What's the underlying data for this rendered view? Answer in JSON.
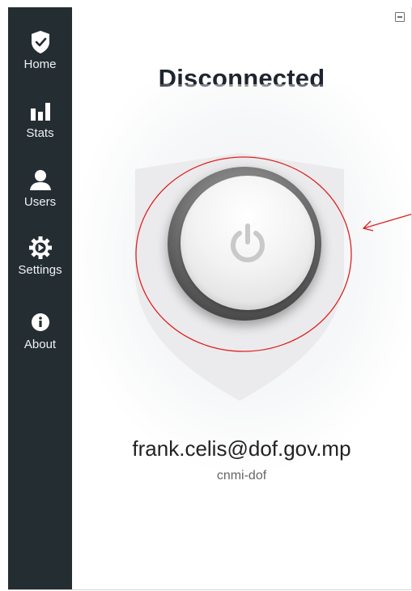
{
  "sidebar": {
    "items": [
      {
        "label": "Home",
        "icon": "shield-check-icon"
      },
      {
        "label": "Stats",
        "icon": "bar-chart-icon"
      },
      {
        "label": "Users",
        "icon": "user-icon"
      },
      {
        "label": "Settings",
        "icon": "gear-icon"
      },
      {
        "label": "About",
        "icon": "info-icon"
      }
    ],
    "background": "#242d32"
  },
  "window_controls": {
    "minimize_icon": "minimize-icon"
  },
  "main": {
    "status": "Disconnected",
    "power_icon": "power-icon",
    "user": {
      "email": "frank.celis@dof.gov.mp",
      "domain": "cnmi-dof"
    }
  },
  "annotation": {
    "color": "#e02020"
  }
}
